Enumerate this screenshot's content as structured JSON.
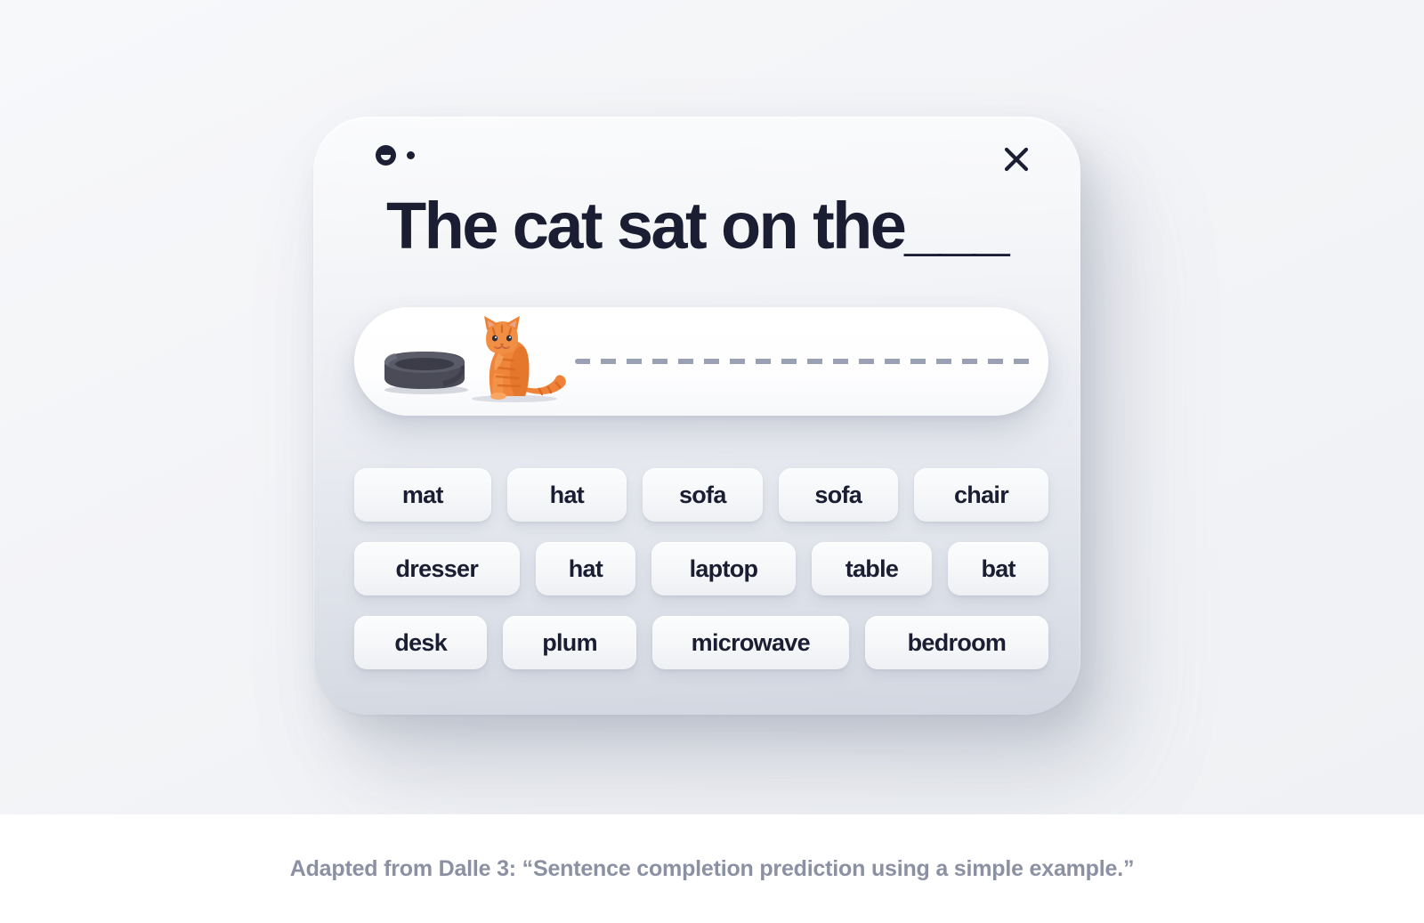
{
  "card": {
    "brand_icon": "two-dots-icon",
    "close_icon": "close-icon",
    "title": "The cat sat on the___",
    "answer_field": {
      "bed_icon": "pet-bed-icon",
      "cat_icon": "orange-tabby-cat-icon",
      "trail": "dashed-line"
    },
    "suggestion_rows": [
      [
        "mat",
        "hat",
        "sofa",
        "sofa",
        "chair"
      ],
      [
        "dresser",
        "hat",
        "laptop",
        "table",
        "bat"
      ],
      [
        "desk",
        "plum",
        "microwave",
        "bedroom"
      ]
    ]
  },
  "caption": {
    "text": "Adapted from Dalle 3: “Sentence completion prediction using a simple example.”"
  },
  "colors": {
    "page_background": "#f4f5f7",
    "caption_background": "#ffffff",
    "text_dark": "#1b1e33",
    "caption_text": "#8b90a3",
    "dash_gray": "#9ba1b5",
    "cat_orange": "#ef7f33",
    "bed_charcoal": "#4a4b57"
  }
}
